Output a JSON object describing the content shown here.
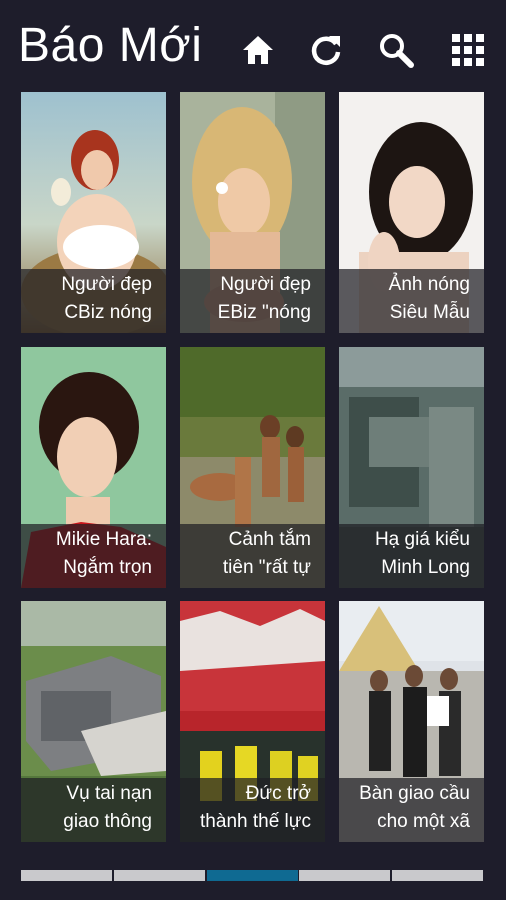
{
  "app": {
    "title": "Báo Mới"
  },
  "toolbar": {
    "buttons": [
      {
        "name": "home-icon"
      },
      {
        "name": "refresh-icon"
      },
      {
        "name": "search-icon"
      },
      {
        "name": "grid-menu-icon"
      }
    ]
  },
  "articles": [
    {
      "line1": "Người đẹp",
      "line2": "CBiz nóng"
    },
    {
      "line1": "Người đẹp",
      "line2": "EBiz \"nóng"
    },
    {
      "line1": "Ảnh nóng",
      "line2": "Siêu Mẫu"
    },
    {
      "line1": "Mikie Hara:",
      "line2": "Ngắm trọn"
    },
    {
      "line1": "Cảnh tắm",
      "line2": "tiên \"rất tự"
    },
    {
      "line1": "Hạ giá kiểu",
      "line2": "Minh Long"
    },
    {
      "line1": "Vụ tai nạn",
      "line2": "giao thông"
    },
    {
      "line1": "Đức trở",
      "line2": "thành thế lực"
    },
    {
      "line1": "Bàn giao cầu",
      "line2": "cho một xã"
    }
  ],
  "pager": {
    "total": 5,
    "active_index": 2
  },
  "colors": {
    "background": "#1e1d2b",
    "accent": "#0f6a92",
    "pager_inactive": "#c9c9cc"
  }
}
